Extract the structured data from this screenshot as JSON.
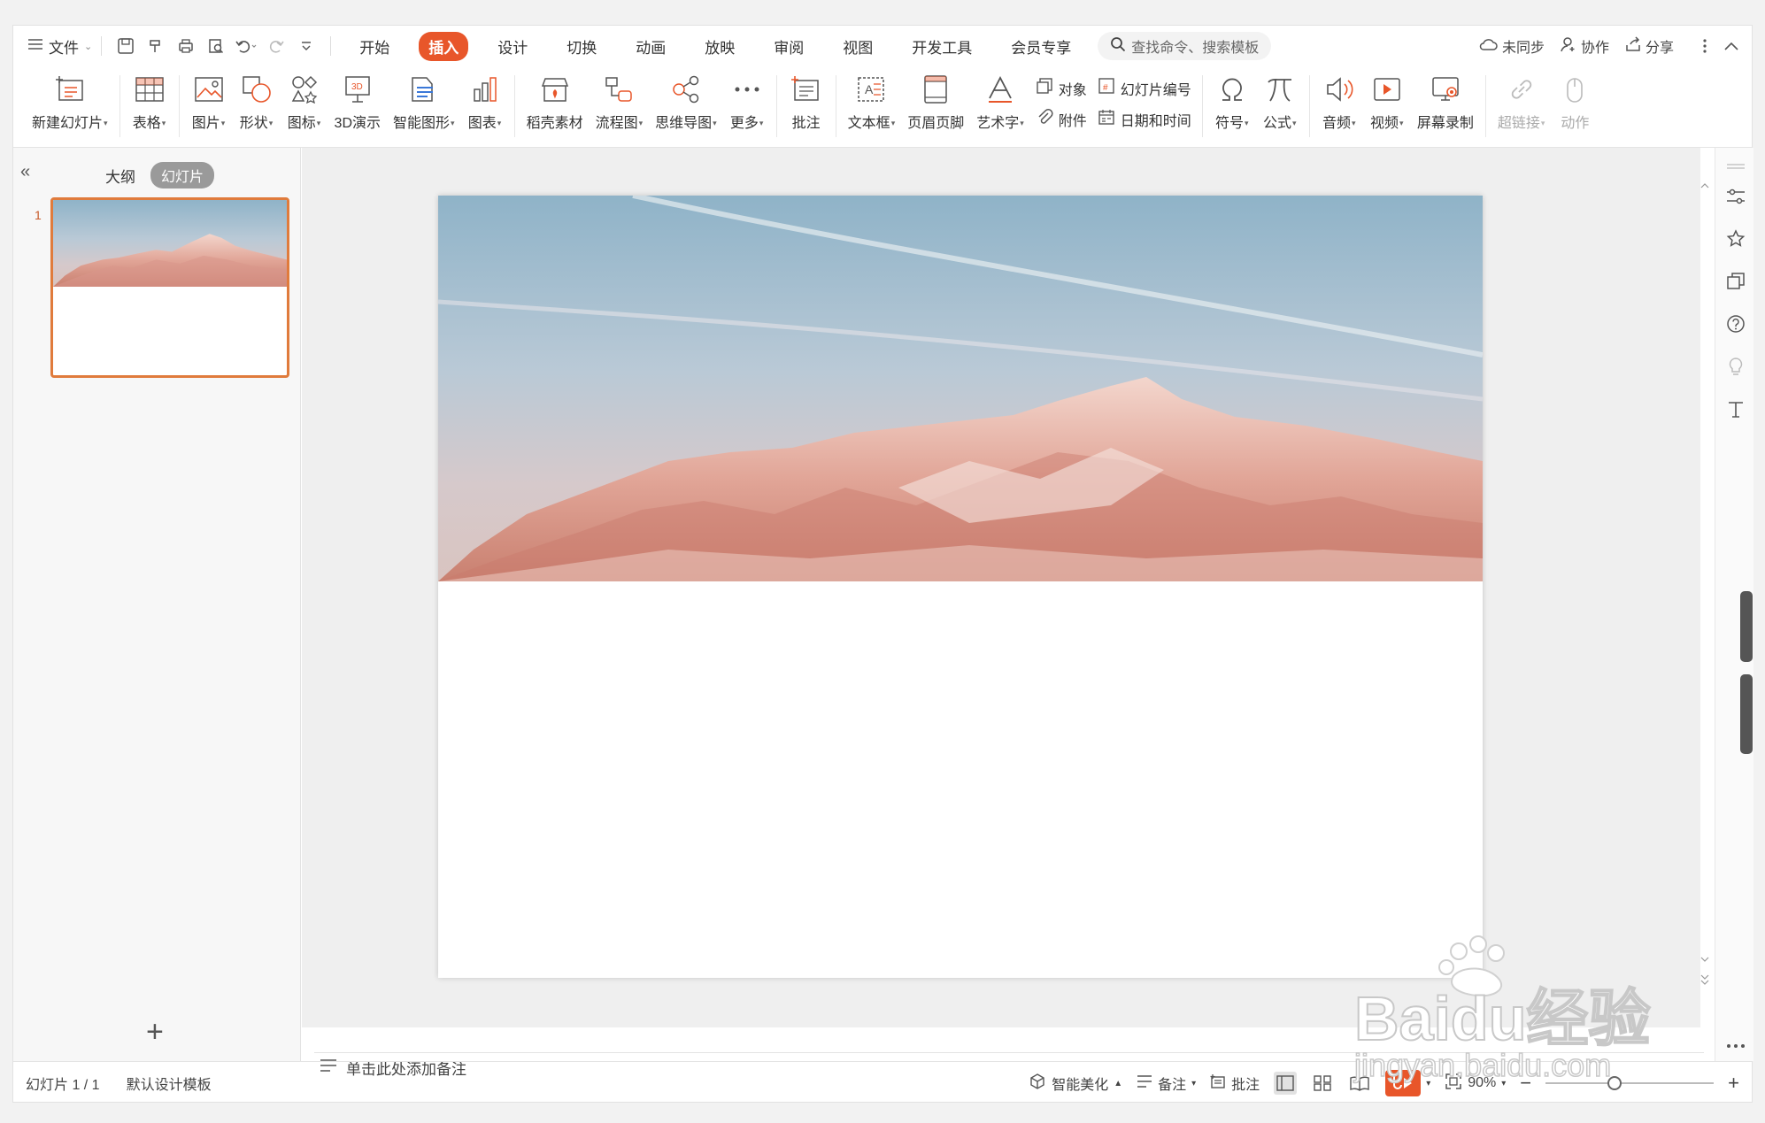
{
  "menu": {
    "file_label": "文件",
    "tabs": [
      {
        "label": "开始"
      },
      {
        "label": "插入",
        "active": true
      },
      {
        "label": "设计"
      },
      {
        "label": "切换"
      },
      {
        "label": "动画"
      },
      {
        "label": "放映"
      },
      {
        "label": "审阅"
      },
      {
        "label": "视图"
      },
      {
        "label": "开发工具"
      },
      {
        "label": "会员专享"
      }
    ],
    "search_placeholder": "查找命令、搜索模板",
    "sync_label": "未同步",
    "collab_label": "协作",
    "share_label": "分享"
  },
  "ribbon": {
    "new_slide": "新建幻灯片",
    "table": "表格",
    "picture": "图片",
    "shape": "形状",
    "icons": "图标",
    "threed": "3D演示",
    "smartart": "智能图形",
    "chart": "图表",
    "daoke": "稻壳素材",
    "flowchart": "流程图",
    "mindmap": "思维导图",
    "more": "更多",
    "comment": "批注",
    "textbox": "文本框",
    "header_footer": "页眉页脚",
    "wordart": "艺术字",
    "object": "对象",
    "attachment": "附件",
    "slide_number": "幻灯片编号",
    "datetime": "日期和时间",
    "symbol": "符号",
    "formula": "公式",
    "audio": "音频",
    "video": "视频",
    "screen_record": "屏幕录制",
    "hyperlink": "超链接",
    "action": "动作"
  },
  "left_panel": {
    "outline_tab": "大纲",
    "slides_tab": "幻灯片",
    "slide_number": "1"
  },
  "notes_placeholder": "单击此处添加备注",
  "status": {
    "slide_info": "幻灯片 1 / 1",
    "template": "默认设计模板",
    "beautify": "智能美化",
    "notes": "备注",
    "comments": "批注",
    "zoom": "90%",
    "zoom_fraction": 0.4
  },
  "watermark": {
    "brand": "Baidu经验",
    "url": "jingyan.baidu.com"
  },
  "colors": {
    "accent": "#e8562a",
    "thumb_border": "#e07b3c"
  }
}
